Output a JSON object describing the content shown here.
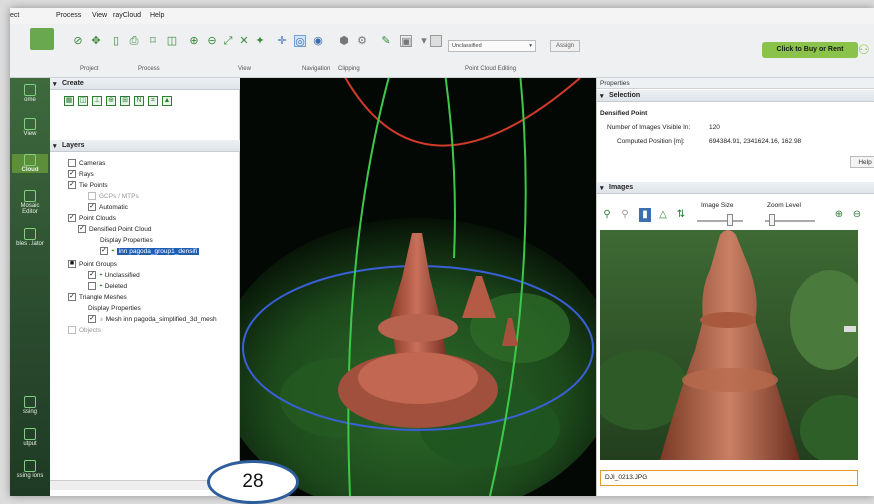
{
  "menu": [
    "ect",
    "Process",
    "View",
    "rayCloud",
    "Help"
  ],
  "toolbar": {
    "group_labels": {
      "project": "Project",
      "process": "Process",
      "view": "View",
      "navigation": "Navigation",
      "clipping": "Clipping",
      "pce": "Point Cloud Editing"
    },
    "class_dropdown": "Unclassified",
    "assign_label": "Assign",
    "buy_rent_label": "Click to Buy or Rent"
  },
  "left_strip": [
    "ome",
    "View",
    "Cloud",
    "Mosaic Editor",
    "bles ..lator",
    "ssing",
    "utput",
    "ssing ions"
  ],
  "create": {
    "title": "Create",
    "icons": [
      "▦",
      "◫",
      "⊥",
      "⊕",
      "⊞",
      "N",
      "⌗",
      "▲"
    ]
  },
  "layers": {
    "title": "Layers",
    "rows": [
      {
        "label": "Cameras",
        "checked": false
      },
      {
        "label": "Rays",
        "checked": true
      },
      {
        "label": "Tie Points",
        "checked": true
      },
      {
        "label": "GCPs / MTPs",
        "checked": false
      },
      {
        "label": "Automatic",
        "checked": true
      },
      {
        "label": "Point Clouds",
        "checked": true
      },
      {
        "label": "Densified Point Cloud",
        "checked": true
      },
      {
        "label": "Display Properties"
      },
      {
        "label": "inn pagoda_group1_densifi",
        "checked": true
      },
      {
        "label": "Point Groups",
        "checked": true
      },
      {
        "label": "Unclassified",
        "checked": true
      },
      {
        "label": "Deleted",
        "checked": false
      },
      {
        "label": "Triangle Meshes",
        "checked": true
      },
      {
        "label": "Display Properties"
      },
      {
        "label": "Mesh inn pagoda_simplified_3d_mesh",
        "checked": true
      },
      {
        "label": "Objects",
        "checked": false
      }
    ]
  },
  "properties": {
    "title": "Properties",
    "selection_title": "Selection",
    "point_heading": "Densified Point",
    "images_visible_label": "Number of Images Visible In:",
    "images_visible_value": "120",
    "position_label": "Computed Position [m]:",
    "position_value": "694384.91, 2341624.16, 162.98",
    "help_label": "Help",
    "images_title": "Images",
    "image_size_label": "Image Size",
    "zoom_level_label": "Zoom Level",
    "filename": "DJI_0213.JPG"
  },
  "page_number": "28",
  "colors": {
    "accent": "#8bc34a",
    "selection": "#1e5fb4",
    "badge_border": "#2e5d9c"
  }
}
